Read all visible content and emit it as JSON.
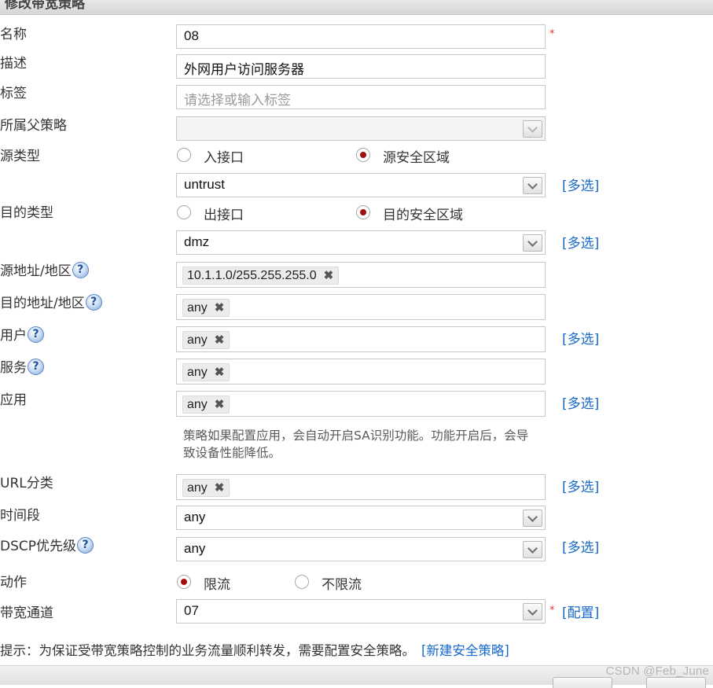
{
  "window": {
    "title": "修改带宽策略"
  },
  "form": {
    "name": {
      "label": "名称",
      "value": "08",
      "required_mark": "*"
    },
    "description": {
      "label": "描述",
      "value": "外网用户访问服务器"
    },
    "tags": {
      "label": "标签",
      "placeholder": "请选择或输入标签"
    },
    "parent_policy": {
      "label": "所属父策略",
      "value": ""
    },
    "source_type": {
      "label": "源类型",
      "options": [
        "入接口",
        "源安全区域"
      ],
      "selected": "源安全区域"
    },
    "source_zone": {
      "value": "untrust",
      "link": "[多选]"
    },
    "dest_type": {
      "label": "目的类型",
      "options": [
        "出接口",
        "目的安全区域"
      ],
      "selected": "目的安全区域"
    },
    "dest_zone": {
      "value": "dmz",
      "link": "[多选]"
    },
    "source_address": {
      "label": "源地址/地区",
      "tag": "10.1.1.0/255.255.255.0"
    },
    "dest_address": {
      "label": "目的地址/地区",
      "tag": "any"
    },
    "user": {
      "label": "用户",
      "tag": "any",
      "link": "[多选]"
    },
    "service": {
      "label": "服务",
      "tag": "any"
    },
    "application": {
      "label": "应用",
      "tag": "any",
      "link": "[多选]",
      "note": "策略如果配置应用，会自动开启SA识别功能。功能开启后，会导致设备性能降低。"
    },
    "url_category": {
      "label": "URL分类",
      "tag": "any",
      "link": "[多选]"
    },
    "time_range": {
      "label": "时间段",
      "value": "any"
    },
    "dscp": {
      "label": "DSCP优先级",
      "value": "any",
      "link": "[多选]"
    },
    "action": {
      "label": "动作",
      "options": [
        "限流",
        "不限流"
      ],
      "selected": "限流"
    },
    "bandwidth_channel": {
      "label": "带宽通道",
      "value": "07",
      "required_mark": "*",
      "link": "[配置]"
    },
    "help_glyph": "?",
    "remove_glyph": "✖"
  },
  "tip": {
    "text": "提示：为保证受带宽策略控制的业务流量顺利转发，需要配置安全策略。",
    "link": "[新建安全策略]"
  },
  "watermark": "CSDN @Feb_June",
  "colors": {
    "link": "#1769c9",
    "required": "#e03a3a",
    "radio_selected": "#a30e0e"
  }
}
